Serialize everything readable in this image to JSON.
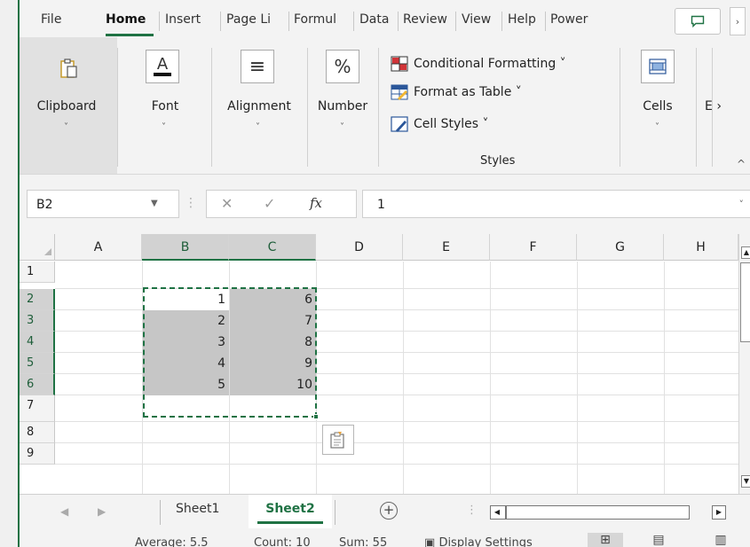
{
  "tabs": [
    "File",
    "Home",
    "Insert",
    "Page Li",
    "Formul",
    "Data",
    "Review",
    "View",
    "Help",
    "Power"
  ],
  "active_tab": "Home",
  "tab_scroll_glyph": "›",
  "ribbon": {
    "clipboard": "Clipboard",
    "font": "Font",
    "alignment": "Alignment",
    "number": "Number",
    "number_glyph": "%",
    "font_glyph": "A",
    "alignment_glyph": "≡",
    "styles": {
      "conditional": "Conditional Formatting ˅",
      "format_table": "Format as Table ˅",
      "cell_styles": "Cell Styles ˅",
      "label": "Styles"
    },
    "cells": "Cells",
    "editing_short": "E",
    "more_glyph": "›",
    "caret": "˅",
    "collapse_glyph": "^"
  },
  "formula_bar": {
    "name_box": "B2",
    "value": "1",
    "fx": "fx",
    "cancel": "✕",
    "enter": "✓",
    "dots": "⋮",
    "expand": "˅"
  },
  "grid": {
    "columns": [
      "A",
      "B",
      "C",
      "D",
      "E",
      "F",
      "G",
      "H"
    ],
    "rows": [
      "1",
      "2",
      "3",
      "4",
      "5",
      "6",
      "7",
      "8",
      "9"
    ],
    "column_b": [
      "1",
      "2",
      "3",
      "4",
      "5"
    ],
    "column_c": [
      "6",
      "7",
      "8",
      "9",
      "10"
    ]
  },
  "sheets": {
    "sheet1": "Sheet1",
    "sheet2": "Sheet2",
    "active": "Sheet2",
    "add": "+"
  },
  "status": {
    "average": "Average: 5.5",
    "count": "Count: 10",
    "sum": "Sum: 55",
    "display_settings": "Display Settings"
  },
  "colors": {
    "accent": "#1f7244",
    "selection_fill": "#c6c6c6"
  }
}
